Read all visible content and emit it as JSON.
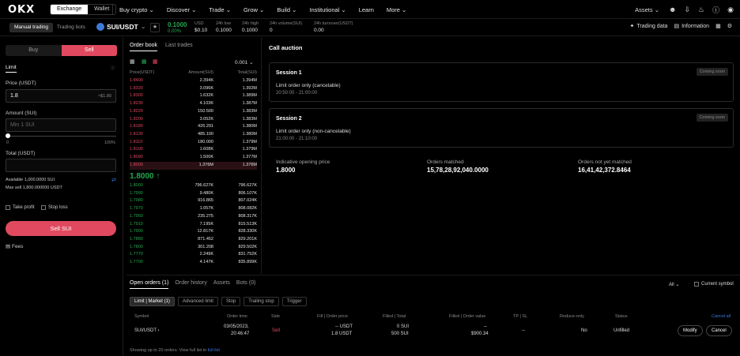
{
  "nav": {
    "logo": "OKX",
    "segments": [
      "Exchange",
      "Wallet"
    ],
    "menu": [
      "Buy crypto ⌄",
      "Discover ⌄",
      "Trade ⌄",
      "Grow ⌄",
      "Build ⌄",
      "Institutional ⌄",
      "Learn",
      "More ⌄"
    ],
    "assets": "Assets ⌄"
  },
  "ticker": {
    "modes": [
      "Manual trading",
      "Trading bots"
    ],
    "pair": "SUI/USDT",
    "price": "0.1000",
    "change": "0.00%",
    "stats": [
      {
        "label": "USD",
        "value": "$0.10"
      },
      {
        "label": "24h low",
        "value": "0.1000"
      },
      {
        "label": "24h high",
        "value": "0.1000"
      },
      {
        "label": "24h volume(SUI)",
        "value": "0"
      },
      {
        "label": "24h turnover(USDT)",
        "value": "0.00"
      }
    ],
    "trading_data": "Trading data",
    "information": "Information"
  },
  "order_form": {
    "buy": "Buy",
    "sell": "Sell",
    "type": "Limit",
    "price_label": "Price (USDT)",
    "price_value": "1.8",
    "price_hint": "≈$1.80",
    "amount_label": "Amount (SUI)",
    "amount_placeholder": "Min 1 SUI",
    "min_pct": "0",
    "max_pct": "100%",
    "total_label": "Total (USDT)",
    "available": "Available 1,000.0000 SUI",
    "max_sell": "Max sell 1,800.000000 USDT",
    "take_profit": "Take profit",
    "stop_loss": "Stop loss",
    "submit": "Sell SUI",
    "fees": "Fees"
  },
  "orderbook": {
    "tabs": [
      "Order book",
      "Last trades"
    ],
    "precision": "0.001 ⌄",
    "headers": [
      "Price(USDT)",
      "Amount(SUI)",
      "Total(SUI)"
    ],
    "asks": [
      [
        "1.8400",
        "2.394K",
        "1.394M"
      ],
      [
        "1.8320",
        "3.096K",
        "1.392M"
      ],
      [
        "1.8300",
        "1.632K",
        "1.389M"
      ],
      [
        "1.8230",
        "4.103K",
        "1.387M"
      ],
      [
        "1.8220",
        "150.500",
        "1.383M"
      ],
      [
        "1.8200",
        "3.052K",
        "1.383M"
      ],
      [
        "1.8180",
        "426.291",
        "1.380M"
      ],
      [
        "1.8130",
        "485.100",
        "1.380M"
      ],
      [
        "1.8110",
        "180.000",
        "1.379M"
      ],
      [
        "1.8100",
        "1.608K",
        "1.379M"
      ],
      [
        "1.8090",
        "1.500K",
        "1.377M"
      ],
      [
        "1.8000",
        "1.376M",
        "1.376M"
      ]
    ],
    "mid": "1.8000 ↑",
    "bids": [
      [
        "1.8000",
        "796.627K",
        "796.627K"
      ],
      [
        "1.7990",
        "9.480K",
        "806.107K"
      ],
      [
        "1.7980",
        "916.865",
        "807.024K"
      ],
      [
        "1.7970",
        "1.057K",
        "808.082K"
      ],
      [
        "1.7950",
        "235.275",
        "808.317K"
      ],
      [
        "1.7910",
        "7.195K",
        "815.513K"
      ],
      [
        "1.7900",
        "12.817K",
        "828.330K"
      ],
      [
        "1.7880",
        "871.452",
        "829.201K"
      ],
      [
        "1.7800",
        "301.208",
        "829.502K"
      ],
      [
        "1.7770",
        "2.249K",
        "831.752K"
      ],
      [
        "1.7700",
        "4.147K",
        "835.899K"
      ]
    ]
  },
  "auction": {
    "title": "Call auction",
    "sessions": [
      {
        "name": "Session 1",
        "desc": "Limit order only (cancelable)",
        "time": "20:50:00 - 21:00:00",
        "status": "Coming soon"
      },
      {
        "name": "Session 2",
        "desc": "Limit order only (non-cancelable)",
        "time": "21:00:00 - 21:10:00",
        "status": "Coming soon"
      }
    ],
    "metrics": [
      {
        "label": "Indicative opening price",
        "value": "1.8000"
      },
      {
        "label": "Orders matched",
        "value": "15,78,28,92,040.0000"
      },
      {
        "label": "Orders not yet matched",
        "value": "16,41,42,372.8464"
      }
    ]
  },
  "orders": {
    "tabs": [
      "Open orders (1)",
      "Order history",
      "Assets",
      "Bots (0)"
    ],
    "filter_all": "All ⌄",
    "current_symbol": "Current symbol",
    "chips": [
      "Limit | Market (1)",
      "Advanced limit",
      "Stop",
      "Trailing stop",
      "Trigger"
    ],
    "headers": [
      "Symbol",
      "Order time",
      "Side",
      "Fill | Order price",
      "Filled | Total",
      "Filled | Order value",
      "TP | SL",
      "Reduce-only",
      "Status"
    ],
    "cancel_all": "Cancel all",
    "row": {
      "symbol": "SUI/USDT ›",
      "time1": "03/05/2023,",
      "time2": "20:46:47",
      "side": "Sell",
      "price1": "-- USDT",
      "price2": "1.8 USDT",
      "filled1": "0 SUI",
      "filled2": "500 SUI",
      "value1": "--",
      "value2": "$900.34",
      "tpsl": "--",
      "reduce": "No",
      "status": "Unfilled",
      "modify": "Modify",
      "cancel": "Cancel"
    },
    "footer": "Showing up to 20 orders. View full list in",
    "footer_link": "full list"
  },
  "colors": {
    "sell": "#e0495f",
    "buy": "#25a750",
    "accent": "#3d7bd9"
  }
}
